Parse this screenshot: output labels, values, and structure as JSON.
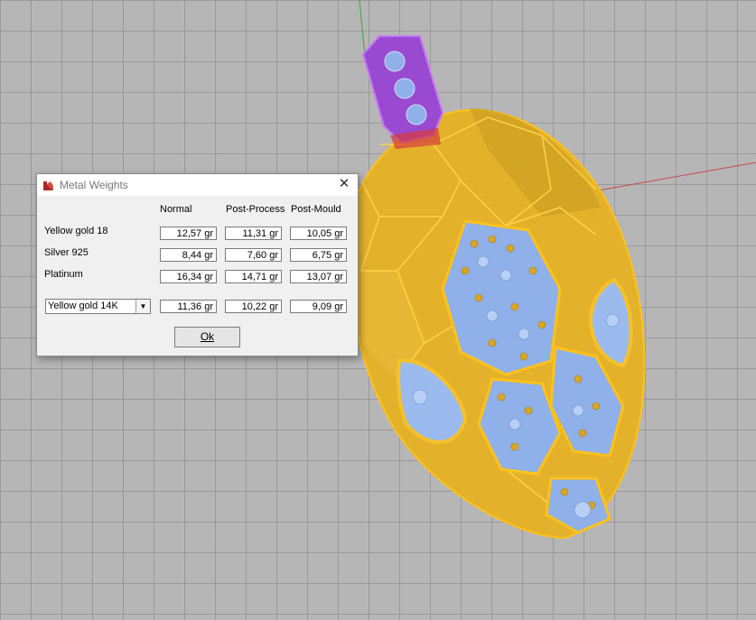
{
  "dialog": {
    "title": "Metal Weights",
    "close_glyph": "✕",
    "columns": [
      "Normal",
      "Post-Process",
      "Post-Mould"
    ],
    "rows": [
      {
        "label": "Yellow gold 18",
        "values": [
          "12,57 gr",
          "11,31 gr",
          "10,05 gr"
        ]
      },
      {
        "label": "Silver 925",
        "values": [
          "8,44 gr",
          "7,60 gr",
          "6,75 gr"
        ]
      },
      {
        "label": "Platinum",
        "values": [
          "16,34 gr",
          "14,71 gr",
          "13,07 gr"
        ]
      }
    ],
    "selected_metal": "Yellow gold 14K",
    "selected_values": [
      "11,36 gr",
      "10,22 gr",
      "9,09 gr"
    ],
    "ok_label": "Ok"
  },
  "icons": {
    "title_icon": "rhino-icon",
    "dropdown": "chevron-down-icon"
  },
  "colors": {
    "viewport_bg": "#b6b6b6",
    "gold": "#e2b22d",
    "gold_edge": "#ffc21a",
    "gem": "#8fb0e8",
    "bail": "#9a4ad0",
    "axis_red": "#c64a4a",
    "axis_green": "#3aa53a"
  }
}
